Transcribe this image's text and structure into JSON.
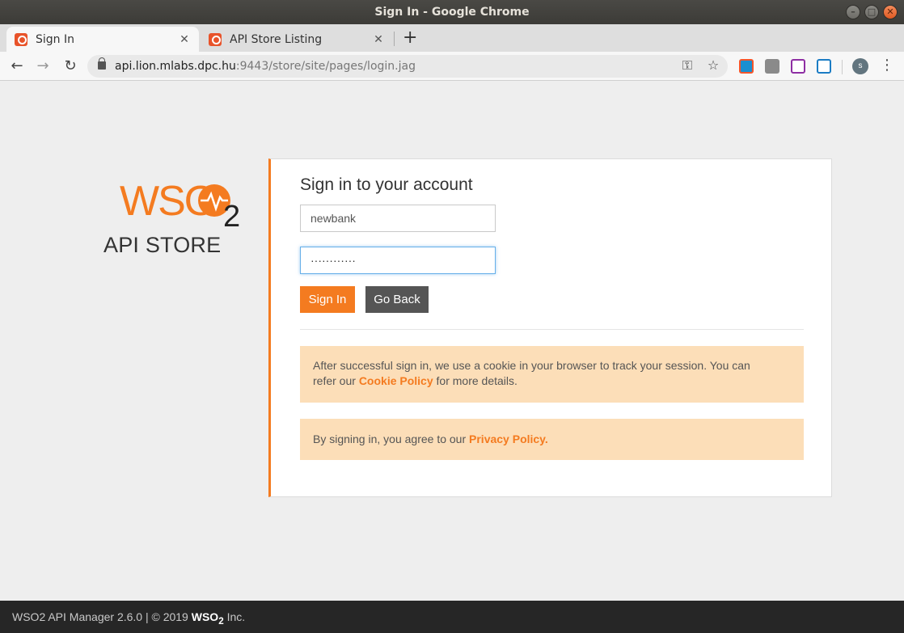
{
  "window": {
    "title": "Sign In - Google Chrome",
    "controls": [
      "–",
      "□",
      "✕"
    ]
  },
  "tabs": [
    {
      "label": "Sign In",
      "active": true,
      "close": "✕"
    },
    {
      "label": "API Store Listing",
      "active": false,
      "close": "✕"
    }
  ],
  "new_tab": "+",
  "address_bar": {
    "host": "api.lion.mlabs.dpc.hu",
    "path": ":9443/store/site/pages/login.jag"
  },
  "nav": {
    "back": "←",
    "forward": "→",
    "reload": "↻"
  },
  "omnibox_icons": {
    "key": "⚿",
    "star": "☆"
  },
  "profile_initial": "s",
  "menu": "⋮",
  "brand": {
    "logo_letters": "WSO",
    "logo_subscript": "2",
    "subtitle": "API STORE",
    "accent_color": "#f47b20"
  },
  "login": {
    "heading": "Sign in to your account",
    "username_value": "newbank",
    "password_mask": "············",
    "sign_in_label": "Sign In",
    "go_back_label": "Go Back"
  },
  "notices": {
    "cookie_text_1": "After successful sign in, we use a cookie in your browser to track your session. You can",
    "cookie_text_2_pre": "refer our ",
    "cookie_link": "Cookie Policy",
    "cookie_text_2_post": " for more details.",
    "privacy_pre": "By signing in, you agree to our ",
    "privacy_link": "Privacy Policy."
  },
  "footer": {
    "text_pre": "WSO2 API Manager 2.6.0 | © 2019 ",
    "logo": "WSO",
    "logo_sub": "2",
    "text_post": " Inc."
  }
}
